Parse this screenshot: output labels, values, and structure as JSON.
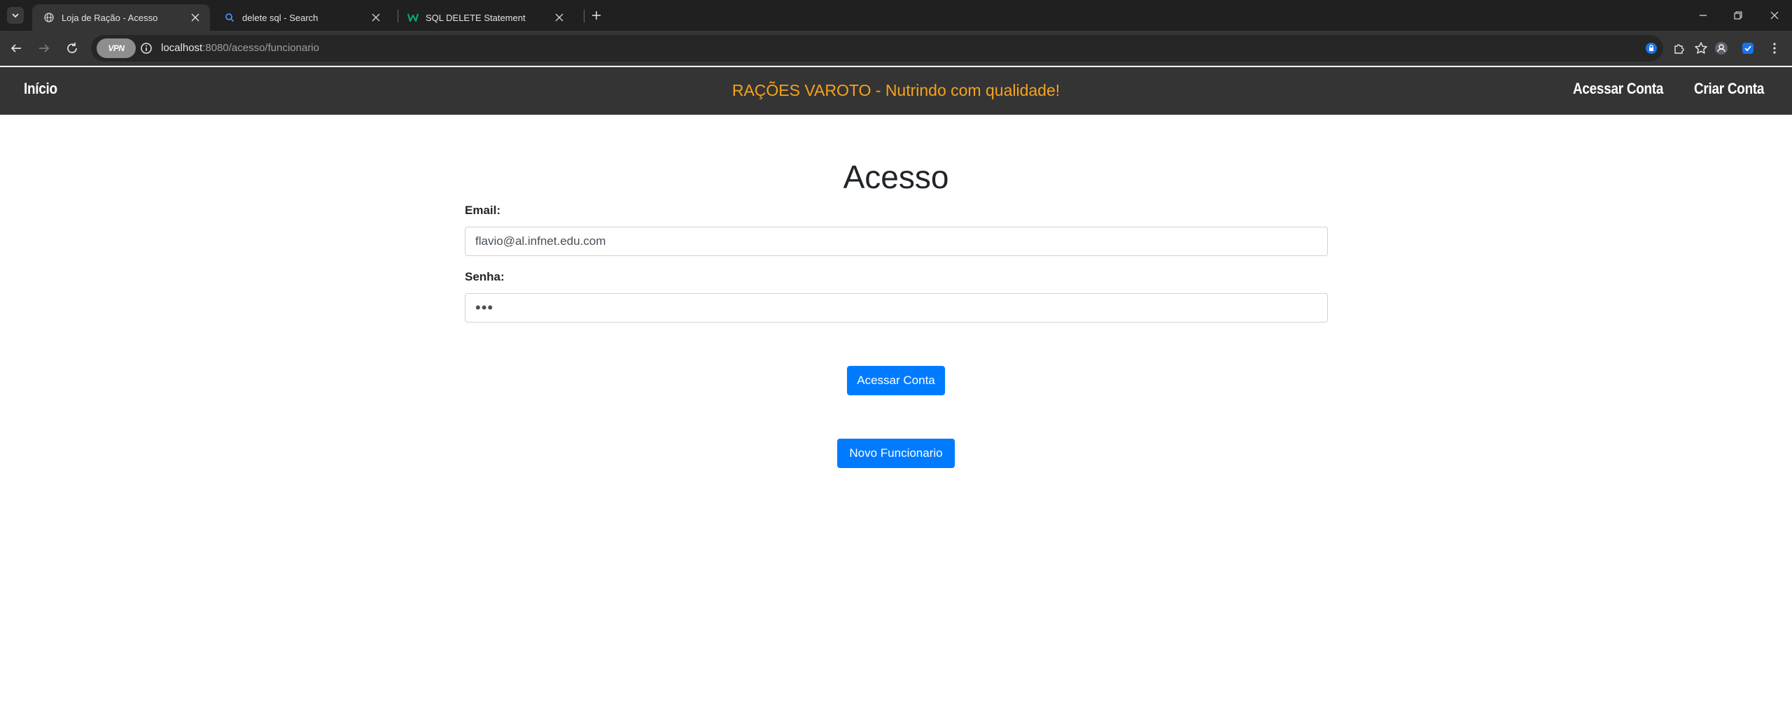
{
  "browser": {
    "tabs": [
      {
        "title": "Loja de Ração - Acesso",
        "active": true,
        "favicon": "globe-icon"
      },
      {
        "title": "delete sql - Search",
        "active": false,
        "favicon": "search-icon"
      },
      {
        "title": "SQL DELETE Statement",
        "active": false,
        "favicon": "w3schools-icon"
      }
    ],
    "vpn_label": "VPN",
    "url_host": "localhost",
    "url_rest": ":8080/acesso/funcionario"
  },
  "navbar": {
    "home_label": "Início",
    "brand": "RAÇÕES VAROTO - Nutrindo com qualidade!",
    "login_label": "Acessar Conta",
    "signup_label": "Criar Conta",
    "brand_color": "#f7a21b"
  },
  "form": {
    "title": "Acesso",
    "email_label": "Email:",
    "email_value": "flavio@al.infnet.edu.com",
    "password_label": "Senha:",
    "password_value": "•••",
    "submit_label": "Acessar Conta",
    "new_employee_label": "Novo Funcionario",
    "button_color": "#007bff"
  }
}
